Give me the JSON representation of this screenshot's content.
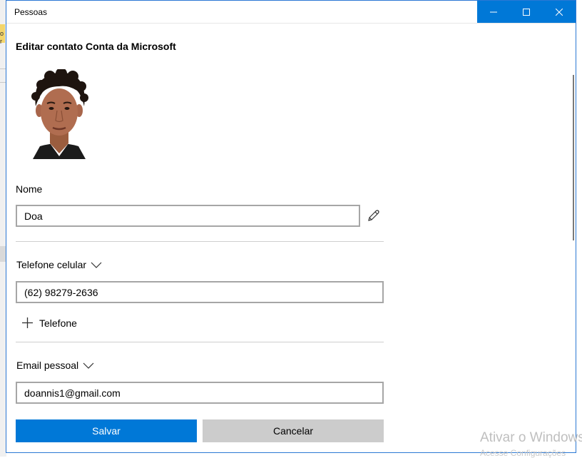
{
  "window": {
    "title": "Pessoas",
    "controls": {
      "minimize": "minimize",
      "maximize": "maximize",
      "close": "close"
    }
  },
  "page": {
    "title": "Editar contato Conta da Microsoft"
  },
  "name_section": {
    "label": "Nome",
    "value": "Doa"
  },
  "phone_section": {
    "label": "Telefone celular",
    "value": "(62) 98279-2636",
    "add_label": "Telefone"
  },
  "email_section": {
    "label": "Email pessoal",
    "value": "doannis1@gmail.com"
  },
  "actions": {
    "save": "Salvar",
    "cancel": "Cancelar"
  },
  "watermark": {
    "line1": "Ativar o Windows",
    "line2": "Acesse Configurações"
  },
  "background_app": {
    "fragment_1": "o",
    "fragment_2": "r"
  },
  "colors": {
    "accent": "#0078d7",
    "cancel_bg": "#cccccc",
    "input_border": "#a6a6a6"
  },
  "icons": [
    "minimize-icon",
    "maximize-icon",
    "close-icon",
    "pencil-icon",
    "chevron-down-icon",
    "plus-icon"
  ]
}
